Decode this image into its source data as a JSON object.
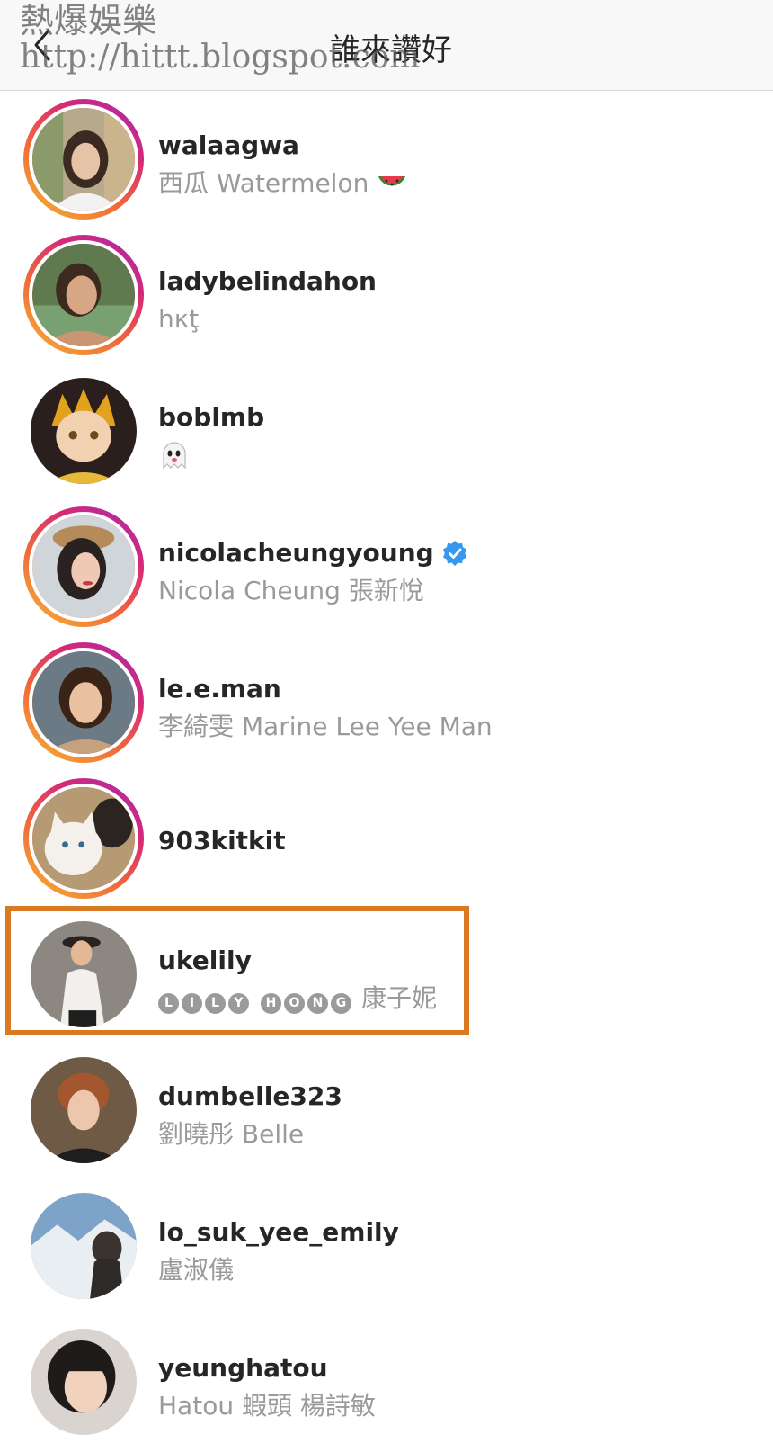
{
  "header": {
    "title": "誰來讚好",
    "back_icon": "chevron-left-icon"
  },
  "watermark": {
    "line1": "熱爆娛樂",
    "line2": "http://hittt.blogspot.com"
  },
  "highlight_color": "#d97a22",
  "users": [
    {
      "username": "walaagwa",
      "fullname": "西瓜 Watermelon",
      "emoji": "watermelon-icon",
      "story_ring": true
    },
    {
      "username": "ladybelindahon",
      "fullname": "hκţ",
      "story_ring": true
    },
    {
      "username": "boblmb",
      "fullname": "",
      "emoji": "ghost-icon",
      "story_ring": false
    },
    {
      "username": "nicolacheungyoung",
      "fullname": "Nicola Cheung 張新悅",
      "verified": true,
      "story_ring": true
    },
    {
      "username": "le.e.man",
      "fullname": "李綺雯 Marine Lee Yee Man",
      "story_ring": true
    },
    {
      "username": "903kitkit",
      "fullname": "",
      "story_ring": true
    },
    {
      "username": "ukelily",
      "fullname_chips": [
        "L",
        "I",
        "L",
        "Y",
        " ",
        "H",
        "O",
        "N",
        "G"
      ],
      "fullname": "康子妮",
      "story_ring": false,
      "highlighted": true
    },
    {
      "username": "dumbelle323",
      "fullname": "劉曉彤 Belle",
      "story_ring": false
    },
    {
      "username": "lo_suk_yee_emily",
      "fullname": "盧淑儀",
      "story_ring": false
    },
    {
      "username": "yeunghatou",
      "fullname": "Hatou 蝦頭 楊詩敏",
      "story_ring": false
    }
  ]
}
